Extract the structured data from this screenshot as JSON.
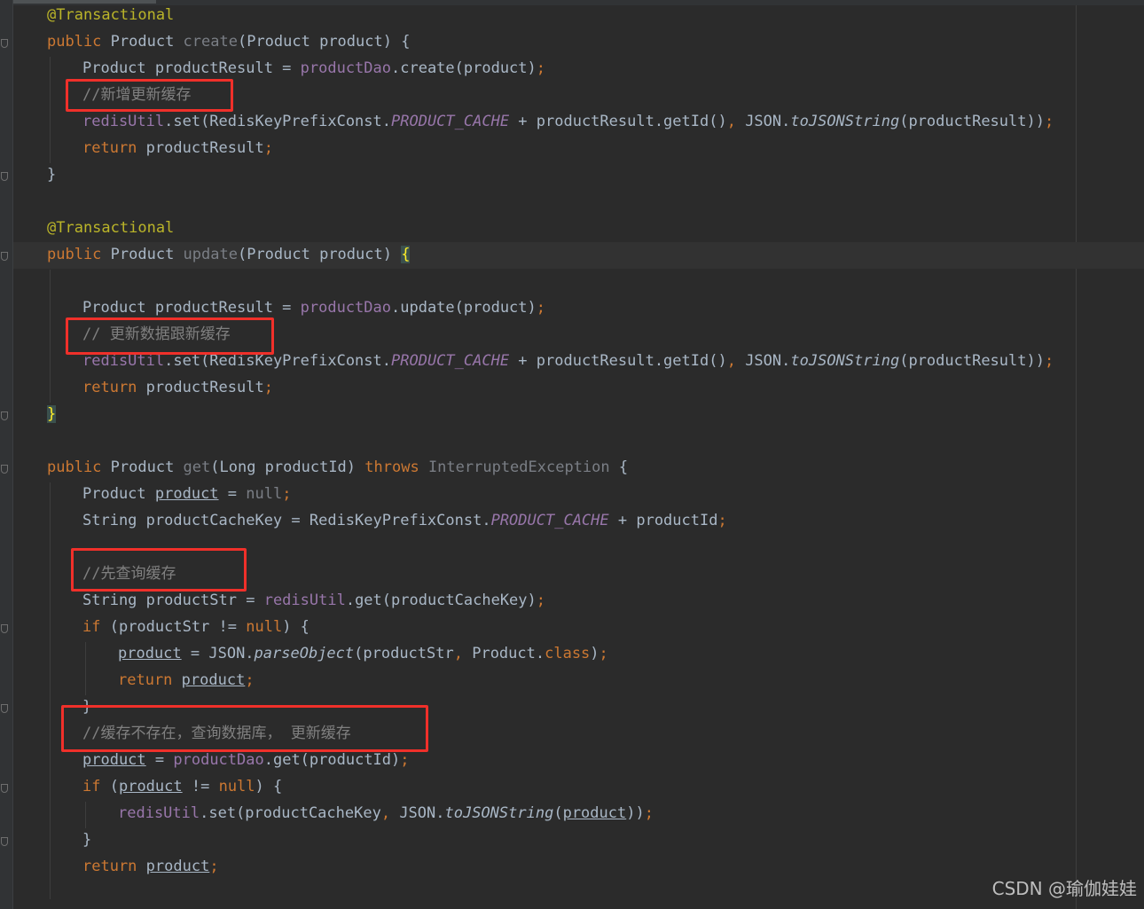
{
  "editor": {
    "lines": [
      {
        "indent": 1,
        "tokens": [
          {
            "t": "@Transactional",
            "c": "ann"
          }
        ]
      },
      {
        "indent": 1,
        "tokens": [
          {
            "t": "public",
            "c": "kw"
          },
          {
            "t": " Product "
          },
          {
            "t": "create",
            "c": "dim"
          },
          {
            "t": "(Product product) {"
          }
        ]
      },
      {
        "indent": 2,
        "tokens": [
          {
            "t": "Product productResult = "
          },
          {
            "t": "productDao",
            "c": "fld"
          },
          {
            "t": ".create(product)"
          },
          {
            "t": ";",
            "c": "kw"
          }
        ]
      },
      {
        "indent": 2,
        "tokens": [
          {
            "t": "//新增更新缓存",
            "c": "cmt"
          }
        ]
      },
      {
        "indent": 2,
        "tokens": [
          {
            "t": "redisUtil",
            "c": "fld"
          },
          {
            "t": ".set(RedisKeyPrefixConst."
          },
          {
            "t": "PRODUCT_CACHE",
            "c": "cst"
          },
          {
            "t": " + productResult.getId()"
          },
          {
            "t": ", ",
            "c": "kw"
          },
          {
            "t": "JSON."
          },
          {
            "t": "toJSONString",
            "c": "it"
          },
          {
            "t": "(productResult))"
          },
          {
            "t": ";",
            "c": "kw"
          }
        ]
      },
      {
        "indent": 2,
        "tokens": [
          {
            "t": "return",
            "c": "kw"
          },
          {
            "t": " productResult"
          },
          {
            "t": ";",
            "c": "kw"
          }
        ]
      },
      {
        "indent": 1,
        "tokens": [
          {
            "t": "}"
          }
        ]
      },
      {
        "indent": 0,
        "tokens": []
      },
      {
        "indent": 1,
        "tokens": [
          {
            "t": "@Transactional",
            "c": "ann"
          }
        ]
      },
      {
        "indent": 1,
        "tokens": [
          {
            "t": "public",
            "c": "kw"
          },
          {
            "t": " Product "
          },
          {
            "t": "update",
            "c": "dim"
          },
          {
            "t": "(Product product) "
          },
          {
            "t": "{",
            "c": "brm"
          }
        ]
      },
      {
        "indent": 0,
        "tokens": []
      },
      {
        "indent": 2,
        "tokens": [
          {
            "t": "Product productResult = "
          },
          {
            "t": "productDao",
            "c": "fld"
          },
          {
            "t": ".update(product)"
          },
          {
            "t": ";",
            "c": "kw"
          }
        ]
      },
      {
        "indent": 2,
        "tokens": [
          {
            "t": "// 更新数据跟新缓存",
            "c": "cmt"
          }
        ]
      },
      {
        "indent": 2,
        "tokens": [
          {
            "t": "redisUtil",
            "c": "fld"
          },
          {
            "t": ".set(RedisKeyPrefixConst."
          },
          {
            "t": "PRODUCT_CACHE",
            "c": "cst"
          },
          {
            "t": " + productResult.getId()"
          },
          {
            "t": ", ",
            "c": "kw"
          },
          {
            "t": "JSON."
          },
          {
            "t": "toJSONString",
            "c": "it"
          },
          {
            "t": "(productResult))"
          },
          {
            "t": ";",
            "c": "kw"
          }
        ]
      },
      {
        "indent": 2,
        "tokens": [
          {
            "t": "return",
            "c": "kw"
          },
          {
            "t": " productResult"
          },
          {
            "t": ";",
            "c": "kw"
          }
        ]
      },
      {
        "indent": 1,
        "tokens": [
          {
            "t": "}",
            "c": "brm"
          }
        ]
      },
      {
        "indent": 0,
        "tokens": []
      },
      {
        "indent": 1,
        "tokens": [
          {
            "t": "public",
            "c": "kw"
          },
          {
            "t": " Product "
          },
          {
            "t": "get",
            "c": "dim"
          },
          {
            "t": "(Long productId) "
          },
          {
            "t": "throws",
            "c": "kw"
          },
          {
            "t": " "
          },
          {
            "t": "InterruptedException",
            "c": "dim"
          },
          {
            "t": " {"
          }
        ]
      },
      {
        "indent": 2,
        "tokens": [
          {
            "t": "Product "
          },
          {
            "t": "product",
            "c": "und"
          },
          {
            "t": " = "
          },
          {
            "t": "null",
            "c": "dim"
          },
          {
            "t": ";",
            "c": "kw"
          }
        ]
      },
      {
        "indent": 2,
        "tokens": [
          {
            "t": "String productCacheKey = RedisKeyPrefixConst."
          },
          {
            "t": "PRODUCT_CACHE",
            "c": "cst"
          },
          {
            "t": " + productId"
          },
          {
            "t": ";",
            "c": "kw"
          }
        ]
      },
      {
        "indent": 0,
        "tokens": []
      },
      {
        "indent": 2,
        "tokens": [
          {
            "t": "//先查询缓存",
            "c": "cmt"
          }
        ]
      },
      {
        "indent": 2,
        "tokens": [
          {
            "t": "String productStr = "
          },
          {
            "t": "redisUtil",
            "c": "fld"
          },
          {
            "t": ".get(productCacheKey)"
          },
          {
            "t": ";",
            "c": "kw"
          }
        ]
      },
      {
        "indent": 2,
        "tokens": [
          {
            "t": "if",
            "c": "kw"
          },
          {
            "t": " (productStr != "
          },
          {
            "t": "null",
            "c": "kw"
          },
          {
            "t": ") {"
          }
        ]
      },
      {
        "indent": 3,
        "tokens": [
          {
            "t": "product",
            "c": "und"
          },
          {
            "t": " = JSON."
          },
          {
            "t": "parseObject",
            "c": "it"
          },
          {
            "t": "(productStr"
          },
          {
            "t": ", ",
            "c": "kw"
          },
          {
            "t": "Product."
          },
          {
            "t": "class",
            "c": "kw"
          },
          {
            "t": ")"
          },
          {
            "t": ";",
            "c": "kw"
          }
        ]
      },
      {
        "indent": 3,
        "tokens": [
          {
            "t": "return",
            "c": "kw"
          },
          {
            "t": " "
          },
          {
            "t": "product",
            "c": "und"
          },
          {
            "t": ";",
            "c": "kw"
          }
        ]
      },
      {
        "indent": 2,
        "tokens": [
          {
            "t": "}"
          }
        ]
      },
      {
        "indent": 2,
        "tokens": [
          {
            "t": "//缓存不存在，查询数据库， 更新缓存",
            "c": "cmt"
          }
        ]
      },
      {
        "indent": 2,
        "tokens": [
          {
            "t": "product",
            "c": "und"
          },
          {
            "t": " = "
          },
          {
            "t": "productDao",
            "c": "fld"
          },
          {
            "t": ".get(productId)"
          },
          {
            "t": ";",
            "c": "kw"
          }
        ]
      },
      {
        "indent": 2,
        "tokens": [
          {
            "t": "if",
            "c": "kw"
          },
          {
            "t": " ("
          },
          {
            "t": "product",
            "c": "und"
          },
          {
            "t": " != "
          },
          {
            "t": "null",
            "c": "kw"
          },
          {
            "t": ") {"
          }
        ]
      },
      {
        "indent": 3,
        "tokens": [
          {
            "t": "redisUtil",
            "c": "fld"
          },
          {
            "t": ".set(productCacheKey"
          },
          {
            "t": ", ",
            "c": "kw"
          },
          {
            "t": "JSON."
          },
          {
            "t": "toJSONString",
            "c": "it"
          },
          {
            "t": "("
          },
          {
            "t": "product",
            "c": "und"
          },
          {
            "t": "))"
          },
          {
            "t": ";",
            "c": "kw"
          }
        ]
      },
      {
        "indent": 2,
        "tokens": [
          {
            "t": "}"
          }
        ]
      },
      {
        "indent": 2,
        "tokens": [
          {
            "t": "return",
            "c": "kw"
          },
          {
            "t": " "
          },
          {
            "t": "product",
            "c": "und"
          },
          {
            "t": ";",
            "c": "kw"
          }
        ]
      }
    ]
  },
  "watermark": "CSDN @瑜伽娃娃",
  "colors": {
    "background": "#2b2b2b",
    "keyword": "#cc7832",
    "annotation": "#bbb529",
    "field": "#9876aa",
    "comment": "#808080",
    "default_text": "#a9b7c6",
    "highlight_box": "#f0302a"
  }
}
